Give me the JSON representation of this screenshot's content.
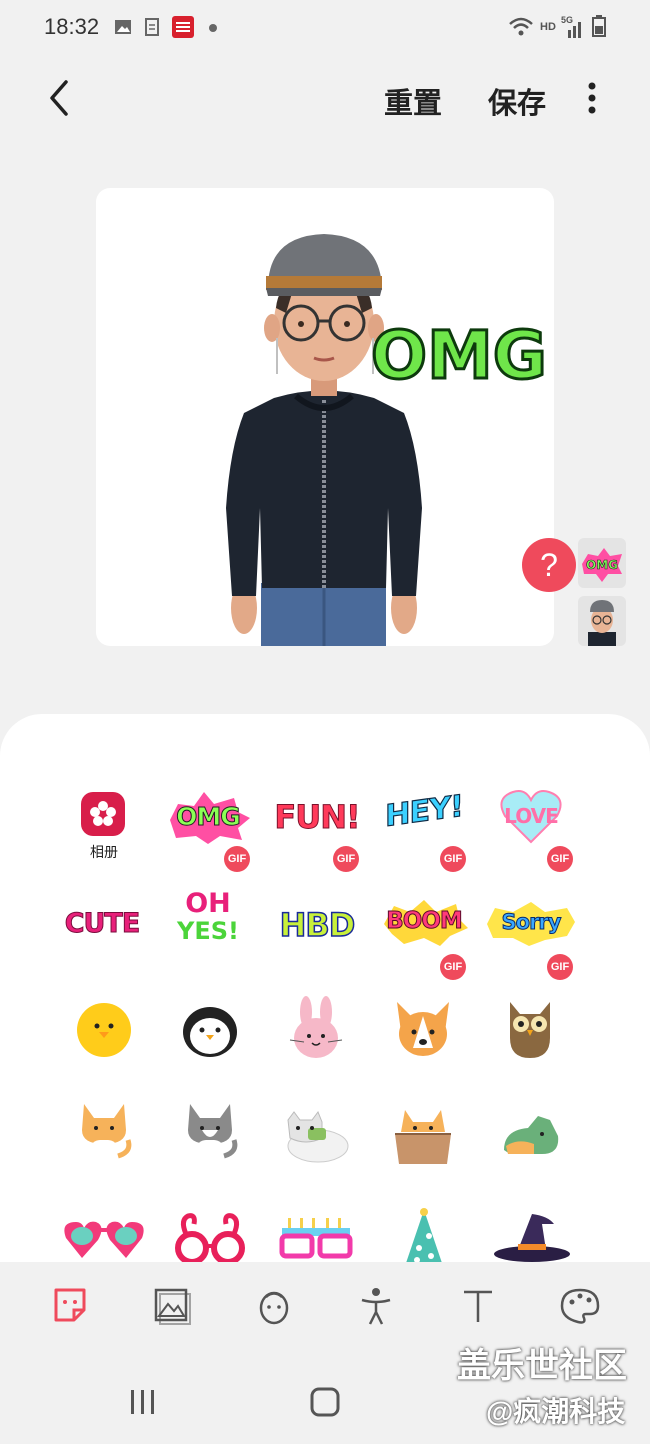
{
  "status": {
    "time": "18:32",
    "network": "HD",
    "signal_label": "5G"
  },
  "header": {
    "reset_label": "重置",
    "save_label": "保存"
  },
  "preview": {
    "sticker_text": "OMG"
  },
  "side": {
    "help_label": "?"
  },
  "panel": {
    "album_label": "相册",
    "gif_label": "GIF",
    "row1": [
      "OMG",
      "FUN!",
      "HEY!",
      "LOVE"
    ],
    "row2": [
      "CUTE",
      "OH",
      "YES!",
      "HBD",
      "BOOM",
      "Sorry"
    ]
  },
  "watermark": {
    "line1": "盖乐世社区",
    "line2": "@疯潮科技"
  },
  "colors": {
    "accent": "#ef4a5c",
    "panel_bg": "#ffffff",
    "page_bg": "#f1f1f1"
  }
}
